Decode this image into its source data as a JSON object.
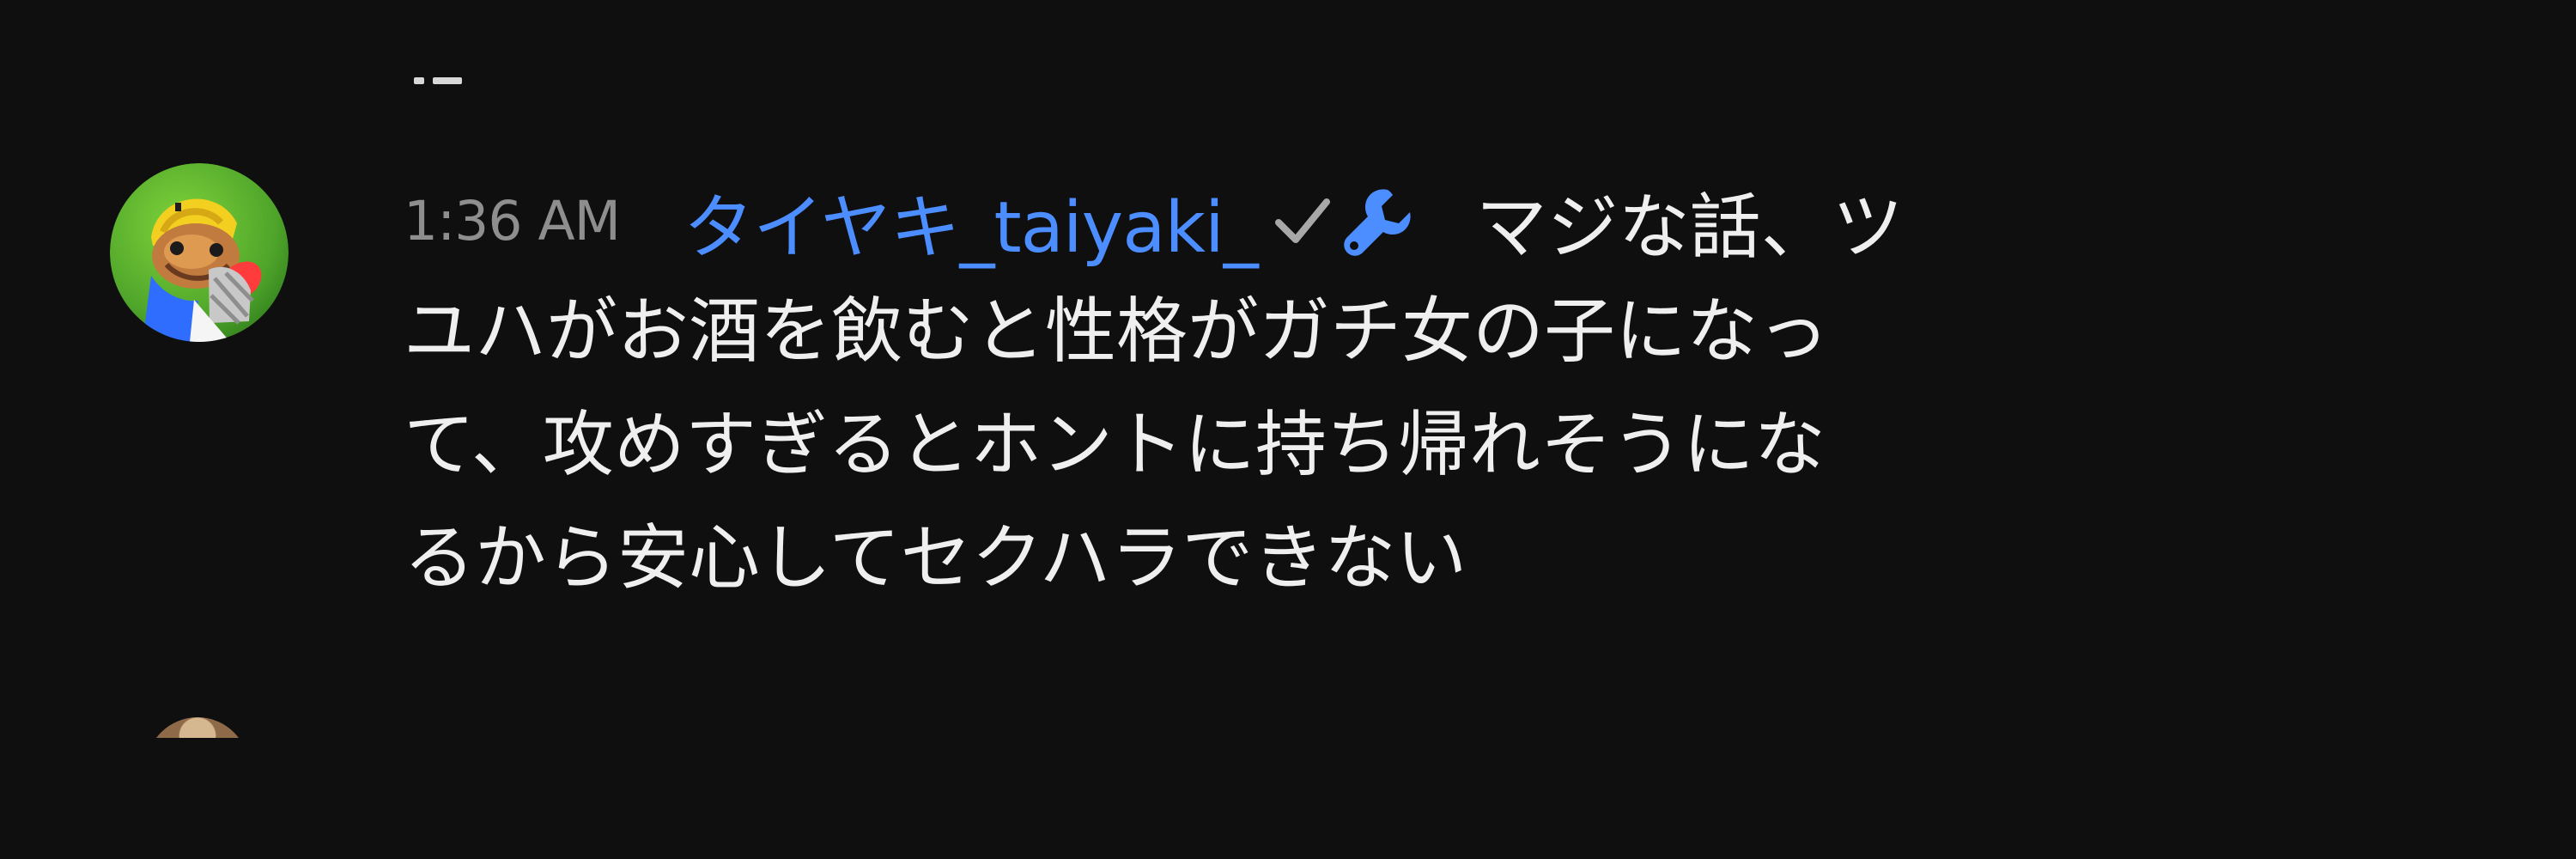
{
  "message": {
    "timestamp": "1:36 AM",
    "author": "タイヤキ_taiyaki_",
    "text_first": "マジな話、ツ",
    "text_rest": "ユハがお酒を飲むと性格がガチ女の子になっ\nて、攻めすぎるとホントに持ち帰れそうにな\nるから安心してセクハラできない",
    "icons": {
      "verified": "check-icon",
      "role": "wrench-icon"
    }
  },
  "colors": {
    "background": "#0f0f10",
    "author": "#4c8dff",
    "timestamp": "#8e8e8e",
    "text": "#efefef"
  }
}
